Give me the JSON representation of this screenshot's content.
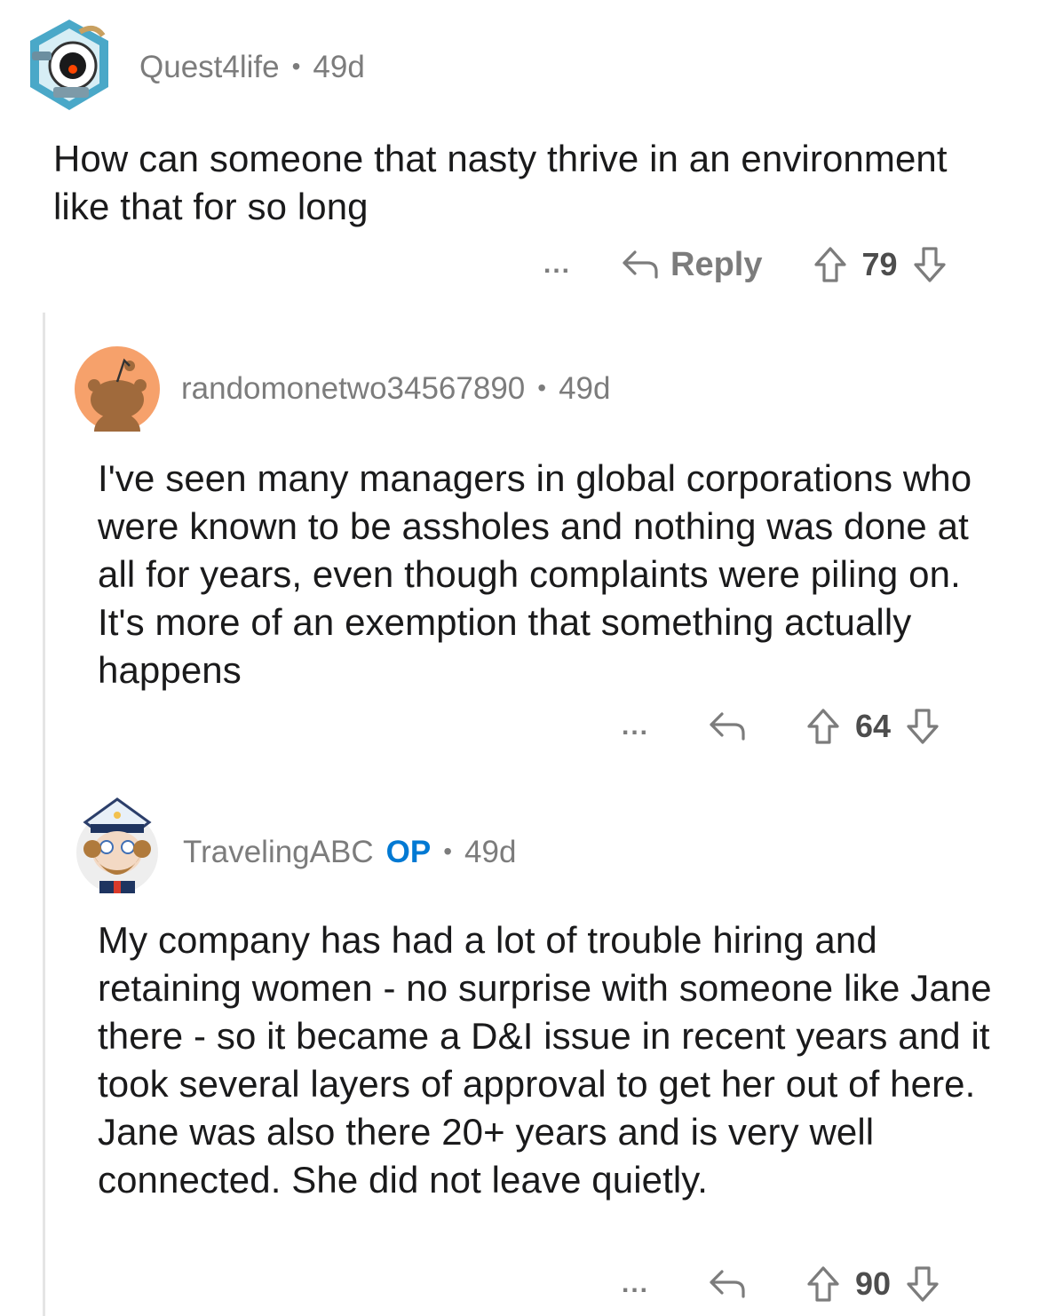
{
  "comments": [
    {
      "username": "Quest4life",
      "age": "49d",
      "body": "How can someone that nasty thrive in an environment like that for so long",
      "reply_label": "Reply",
      "score": "79",
      "more": "..."
    },
    {
      "username": "randomonetwo34567890",
      "age": "49d",
      "body": "I've seen many managers in global corporations who were known to be assholes and nothing was done at all for years, even though complaints were piling on. It's more of an exemption that something actually happens",
      "score": "64",
      "more": "..."
    },
    {
      "username": "TravelingABC",
      "op_badge": "OP",
      "age": "49d",
      "body": "My company has had a lot of trouble hiring and retaining women - no surprise with someone like Jane there - so it became a D&I issue in recent years and it took several layers of approval to get her out of here. Jane was also there 20+ years and is very well connected. She did not leave quietly.",
      "score": "90",
      "more": "..."
    }
  ],
  "separator": "•",
  "colors": {
    "op": "#0079d3",
    "meta": "#7c7c7c",
    "text": "#1a1a1b"
  },
  "icons": [
    "robot-avatar",
    "snoo-avatar",
    "captain-avatar",
    "reply-icon",
    "upvote-icon",
    "downvote-icon"
  ]
}
